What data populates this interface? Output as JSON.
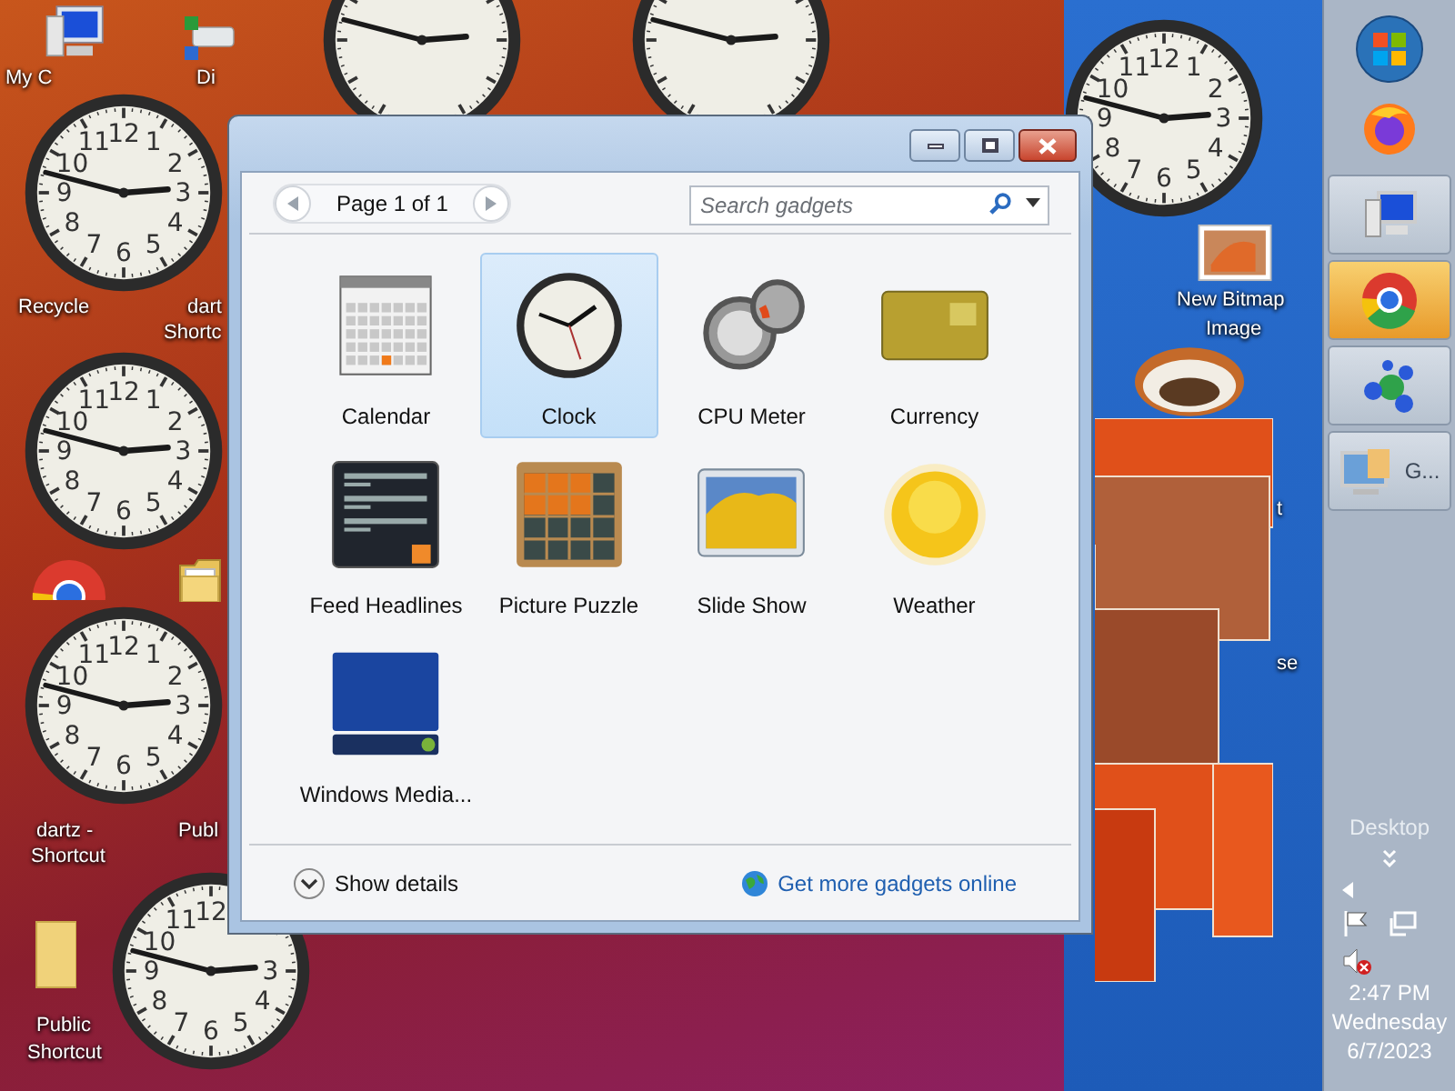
{
  "desktop": {
    "icon_labels": [
      {
        "text": "My C",
        "kind": "computer"
      },
      {
        "text": "Di",
        "kind": "drive"
      },
      {
        "text": "Recycle",
        "kind": "none"
      },
      {
        "text": "dart",
        "kind": "none"
      },
      {
        "text": "Shortc",
        "kind": "none"
      },
      {
        "text": "dartz -",
        "kind": "shortcut"
      },
      {
        "text": "Shortcut",
        "kind": "none"
      },
      {
        "text": "Publ",
        "kind": "folder"
      },
      {
        "text": "Public",
        "kind": "folder"
      },
      {
        "text": "Shortcut",
        "kind": "none"
      },
      {
        "text": "New Bitmap",
        "kind": "bitmap"
      },
      {
        "text": "Image",
        "kind": "none"
      },
      {
        "text": "t",
        "kind": "none"
      },
      {
        "text": "se",
        "kind": "none"
      }
    ],
    "clocks": [
      {
        "numerals": [
          {
            "text": "12",
            "kind": "h12"
          },
          {
            "text": "11",
            "kind": "h11"
          },
          {
            "text": "1",
            "kind": "h1"
          },
          {
            "text": "10",
            "kind": "h10"
          },
          {
            "text": "2",
            "kind": "h2"
          },
          {
            "text": "9",
            "kind": "h9"
          },
          {
            "text": "3",
            "kind": "h3"
          },
          {
            "text": "8",
            "kind": "h8"
          },
          {
            "text": "4",
            "kind": "h4"
          },
          {
            "text": "7",
            "kind": "h7"
          },
          {
            "text": "6",
            "kind": "h6"
          },
          {
            "text": "5",
            "kind": "h5"
          }
        ]
      },
      {
        "numerals": [
          {
            "text": "12",
            "kind": "h12"
          },
          {
            "text": "11",
            "kind": "h11"
          },
          {
            "text": "1",
            "kind": "h1"
          },
          {
            "text": "10",
            "kind": "h10"
          },
          {
            "text": "2",
            "kind": "h2"
          },
          {
            "text": "9",
            "kind": "h9"
          },
          {
            "text": "3",
            "kind": "h3"
          },
          {
            "text": "8",
            "kind": "h8"
          },
          {
            "text": "4",
            "kind": "h4"
          },
          {
            "text": "7",
            "kind": "h7"
          },
          {
            "text": "6",
            "kind": "h6"
          },
          {
            "text": "5",
            "kind": "h5"
          }
        ]
      },
      {
        "numerals": [
          {
            "text": "12",
            "kind": "h12"
          },
          {
            "text": "11",
            "kind": "h11"
          },
          {
            "text": "1",
            "kind": "h1"
          },
          {
            "text": "10",
            "kind": "h10"
          },
          {
            "text": "2",
            "kind": "h2"
          },
          {
            "text": "9",
            "kind": "h9"
          },
          {
            "text": "3",
            "kind": "h3"
          },
          {
            "text": "8",
            "kind": "h8"
          },
          {
            "text": "4",
            "kind": "h4"
          },
          {
            "text": "7",
            "kind": "h7"
          },
          {
            "text": "6",
            "kind": "h6"
          },
          {
            "text": "5",
            "kind": "h5"
          }
        ]
      },
      {
        "numerals": [
          {
            "text": "12",
            "kind": "h12"
          },
          {
            "text": "11",
            "kind": "h11"
          },
          {
            "text": "10",
            "kind": "h10"
          },
          {
            "text": "9",
            "kind": "h9"
          },
          {
            "text": "3",
            "kind": "h3"
          },
          {
            "text": "8",
            "kind": "h8"
          },
          {
            "text": "4",
            "kind": "h4"
          },
          {
            "text": "7",
            "kind": "h7"
          },
          {
            "text": "6",
            "kind": "h6"
          },
          {
            "text": "5",
            "kind": "h5"
          }
        ]
      },
      {
        "numerals": [
          {
            "text": "12",
            "kind": "h12"
          },
          {
            "text": "11",
            "kind": "h11"
          },
          {
            "text": "1",
            "kind": "h1"
          },
          {
            "text": "10",
            "kind": "h10"
          },
          {
            "text": "2",
            "kind": "h2"
          },
          {
            "text": "9",
            "kind": "h9"
          },
          {
            "text": "3",
            "kind": "h3"
          },
          {
            "text": "8",
            "kind": "h8"
          },
          {
            "text": "4",
            "kind": "h4"
          },
          {
            "text": "7",
            "kind": "h7"
          },
          {
            "text": "6",
            "kind": "h6"
          },
          {
            "text": "5",
            "kind": "h5"
          }
        ]
      }
    ]
  },
  "window": {
    "pager": {
      "label": "Page 1 of 1"
    },
    "search": {
      "placeholder": "Search gadgets"
    },
    "gadgets": [
      {
        "name": "Calendar",
        "kind": "calendar",
        "selected": false
      },
      {
        "name": "Clock",
        "kind": "clock",
        "selected": true
      },
      {
        "name": "CPU Meter",
        "kind": "cpu",
        "selected": false
      },
      {
        "name": "Currency",
        "kind": "currency",
        "selected": false
      },
      {
        "name": "Feed Headlines",
        "kind": "feed",
        "selected": false
      },
      {
        "name": "Picture Puzzle",
        "kind": "puzzle",
        "selected": false
      },
      {
        "name": "Slide Show",
        "kind": "slideshow",
        "selected": false
      },
      {
        "name": "Weather",
        "kind": "weather",
        "selected": false
      },
      {
        "name": "Windows Media...",
        "kind": "media",
        "selected": false
      }
    ],
    "details_button": "Show details",
    "online_link": "Get more gadgets online"
  },
  "taskbar": {
    "buttons": [
      {
        "kind": "firefox",
        "running": false,
        "selected": false
      },
      {
        "kind": "computer",
        "running": true,
        "selected": false
      },
      {
        "kind": "chrome",
        "running": true,
        "selected": true
      },
      {
        "kind": "network",
        "running": true,
        "selected": false
      },
      {
        "kind": "gadgets",
        "running": true,
        "selected": false,
        "label": "G..."
      }
    ],
    "desktop_label": "Desktop",
    "sound_muted": true,
    "time": "2:47 PM",
    "day": "Wednesday",
    "date": "6/7/2023"
  }
}
